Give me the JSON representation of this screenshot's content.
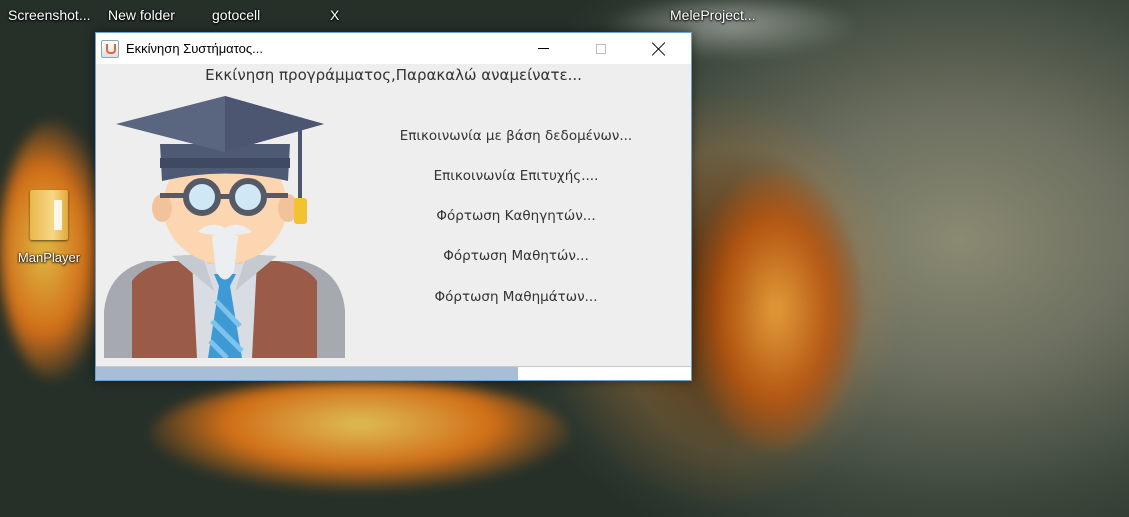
{
  "desktop": {
    "top_labels": [
      "Screenshot...",
      "New folder",
      "gotocell",
      "X",
      "MeleProject..."
    ],
    "icons": [
      {
        "label": "ManPlayer",
        "icon": "folder-icon"
      }
    ]
  },
  "window": {
    "title": "Εκκίνηση Συστήματος...",
    "app_icon": "java-icon",
    "controls": [
      "minimize",
      "maximize",
      "close"
    ],
    "header": "Εκκίνηση προγράμματος,Παρακαλώ αναμείνατε...",
    "status_lines": [
      "Επικοινωνία με βάση δεδομένων...",
      "Επικοινωνία Επιτυχής....",
      "Φόρτωση Καθηγητών...",
      "Φόρτωση Μαθητών...",
      "Φόρτωση Μαθημάτων..."
    ],
    "illustration": "professor-avatar",
    "progress": 0.71,
    "colors": {
      "progress_fill": "#a8bdd6",
      "window_bg": "#eeeeee",
      "border": "#6f9fd0"
    }
  }
}
